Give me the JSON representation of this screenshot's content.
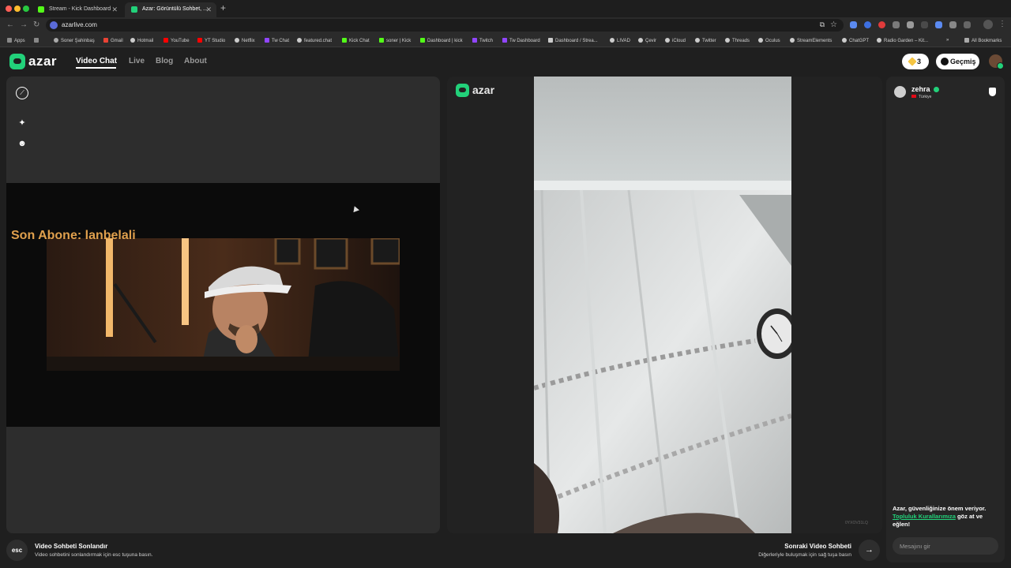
{
  "browser": {
    "tabs": [
      {
        "title": "Stream - Kick Dashboard",
        "favicon_color": "#53fc18"
      },
      {
        "title": "Azar: Görüntülü Sohbet, ...",
        "favicon_color": "#22d17a"
      }
    ],
    "url": "azarlive.com",
    "bookmarks": [
      "Apps",
      "Soner Şahinbaş",
      "Gmail",
      "Hotmail",
      "YouTube",
      "YT Studio",
      "Netflix",
      "Tw Chat",
      "featured.chat",
      "Kick Chat",
      "soner | Kick",
      "Dashboard | kick",
      "Twitch",
      "Tw Dashboard",
      "Dashboard / Strea...",
      "LIVAD",
      "Çevir",
      "iCloud",
      "Twitter",
      "Threads",
      "Oculus",
      "StreamElements",
      "ChatGPT",
      "Radio Garden – Kit..."
    ],
    "all_bookmarks_label": "All Bookmarks"
  },
  "header": {
    "logo": "azar",
    "nav": [
      "Video Chat",
      "Live",
      "Blog",
      "About"
    ],
    "gems": "3",
    "history_label": "Geçmiş"
  },
  "left_panel": {
    "overlay_text": "Son Abone: lanbelali"
  },
  "right_panel": {
    "logo": "azar",
    "watermark": "0YXOV31LQ"
  },
  "chat": {
    "partner_name": "zehra",
    "partner_country": "Türkiye",
    "safety_prefix": "Azar, güvenliğinize önem veriyor.",
    "safety_link": "Topluluk Kurallarımıza",
    "safety_suffix": "göz at ve eğlen!",
    "input_placeholder": "Mesajını gir"
  },
  "footer": {
    "esc_key": "esc",
    "end_title": "Video Sohbeti Sonlandır",
    "end_desc": "Video sohbetini sonlandırmak için esc tuşuna basın.",
    "next_title": "Sonraki Video Sohbeti",
    "next_desc": "Diğerleriyle buluşmak için sağ tuşa basın",
    "next_icon": "→"
  },
  "colors": {
    "brand": "#22d17a",
    "overlay_text": "#e0a04d",
    "background": "#1f1f1f"
  }
}
